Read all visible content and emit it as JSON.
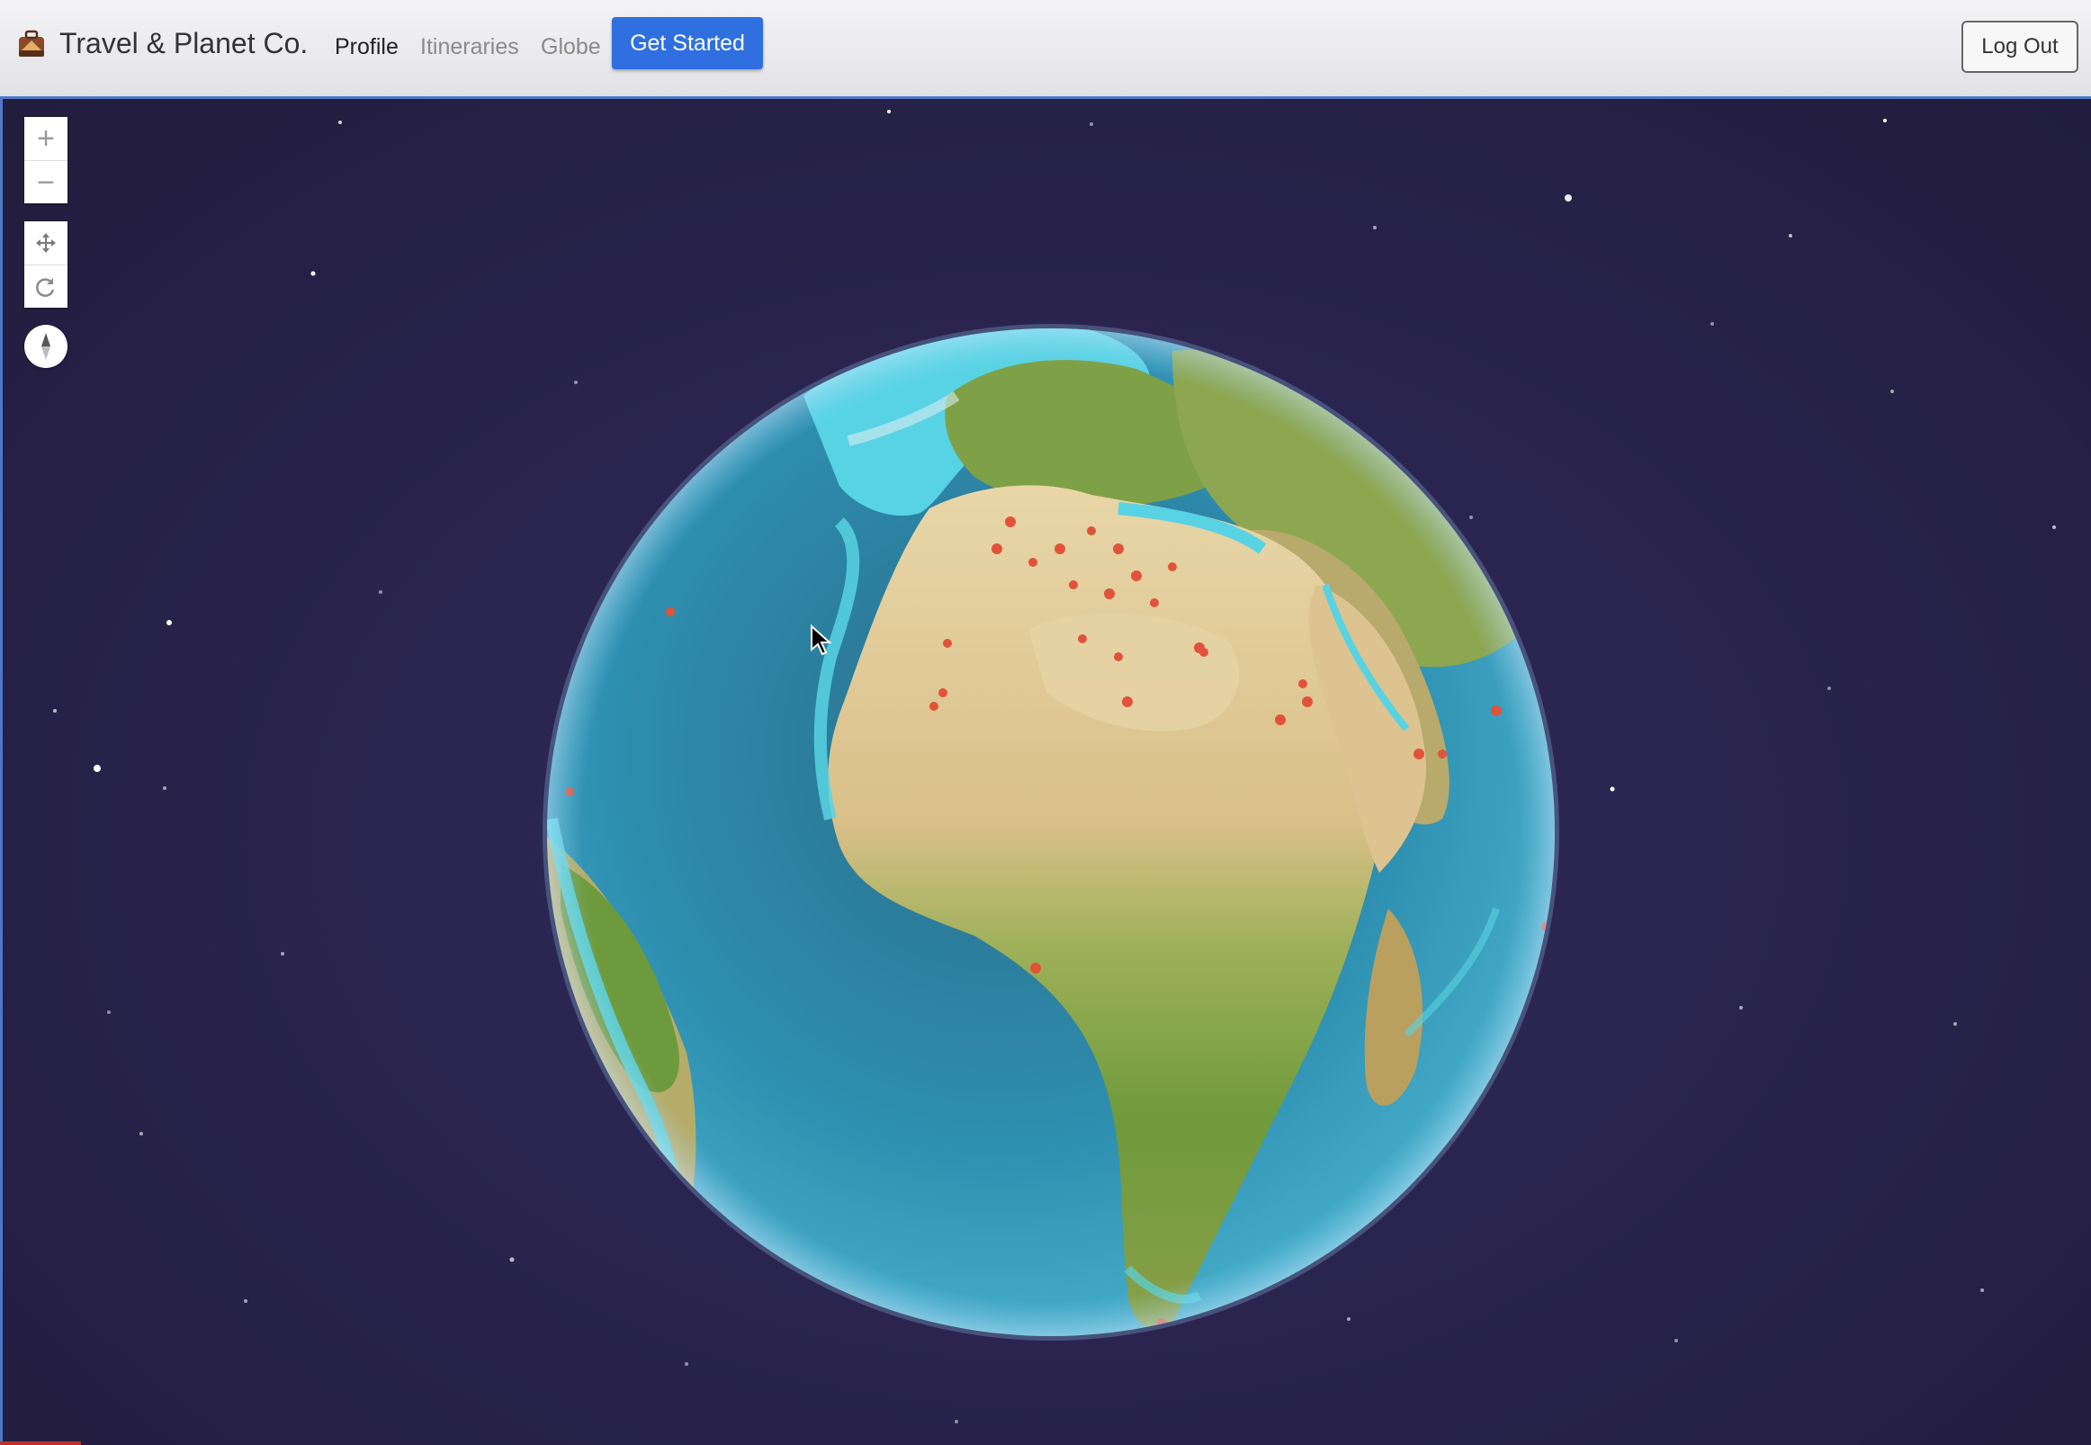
{
  "app": {
    "brand_name": "Travel & Planet Co.",
    "brand_icon": "luggage-logo-icon"
  },
  "nav": {
    "links": [
      {
        "label": "Profile",
        "state": "active"
      },
      {
        "label": "Itineraries",
        "state": "muted"
      },
      {
        "label": "Globe",
        "state": "muted"
      }
    ],
    "cta_label": "Get Started",
    "logout_label": "Log Out"
  },
  "map_controls": {
    "zoom_in_icon": "plus-icon",
    "zoom_out_icon": "minus-icon",
    "pan_icon": "move-arrows-icon",
    "rotate_icon": "rotate-icon",
    "compass_icon": "compass-needle-icon"
  },
  "colors": {
    "accent": "#2f6fe0",
    "space_background": "#2a2448",
    "ocean": "#2e8fb0",
    "shallow_water": "#4fd2e6",
    "marker": "#e0533a"
  }
}
